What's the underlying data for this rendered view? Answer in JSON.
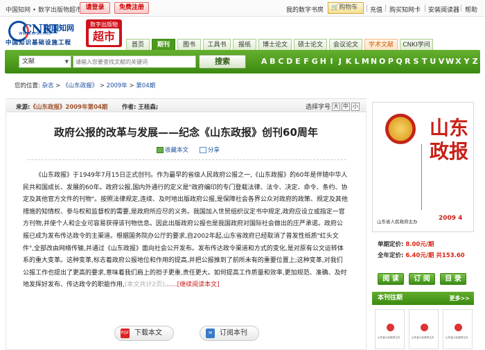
{
  "topbar": {
    "site_name": "中国知网 • 数字出版物超市",
    "login": "请登录",
    "register": "免费注册",
    "my_store": "我的数字书房",
    "cart": "购物车",
    "recharge": "充值",
    "buy_card": "购买知网卡",
    "install_reader": "安装阅读器",
    "help": "帮助"
  },
  "logo": {
    "brand": "CNKI",
    "brand_cn": "中国知网",
    "url": "www.cnki.net",
    "slogan": "中国知识基础设施工程",
    "badge_top": "数字出版物",
    "badge_main": "超市"
  },
  "nav": {
    "tabs": [
      {
        "label": "首页",
        "w": 34
      },
      {
        "label": "期刊",
        "w": 34,
        "active": true
      },
      {
        "label": "图书",
        "w": 34
      },
      {
        "label": "工具书",
        "w": 40
      },
      {
        "label": "报纸",
        "w": 34
      },
      {
        "label": "博士论文",
        "w": 48
      },
      {
        "label": "硕士论文",
        "w": 48
      },
      {
        "label": "会议论文",
        "w": 48
      },
      {
        "label": "学术文献",
        "w": 48,
        "orange": true
      },
      {
        "label": "CNKI学问",
        "w": 48
      }
    ]
  },
  "search": {
    "category": "文献",
    "placeholder": "请输入您要查找文献的关键词",
    "button": "搜索",
    "alphabet": [
      "A",
      "B",
      "C",
      "D",
      "E",
      "F",
      "G",
      "H",
      "I",
      "J",
      "K",
      "L",
      "M",
      "N",
      "O",
      "P",
      "Q",
      "R",
      "S",
      "T",
      "U",
      "V",
      "W",
      "X",
      "Y",
      "Z"
    ]
  },
  "breadcrumb": {
    "prefix": "您的位置:",
    "items": [
      "杂志",
      "《山东政报》",
      "2009年",
      "第04期"
    ]
  },
  "article": {
    "source_label": "来源:",
    "source": "《山东政报》2009年第04期",
    "author_label": "作者:",
    "author": "王桂森;",
    "font_size_label": "选择字号",
    "font_sizes": [
      "大",
      "中",
      "小"
    ],
    "title": "政府公报的改革与发展——纪念《山东政报》创刊60周年",
    "collect": "收藏本文",
    "share": "分享",
    "body": "《山东政报》于1949年7月15日正式创刊。作为最早的省级人民政府公报之一,《山东政报》的60年是伴随中华人民共和国成长、发展的60年。政府公报,国内外通行的定义是\"政府编印的专门登载法律、法令、决定、命令、条约、协定及其他官方文件的刊物\"。按照法律规定,连续、及时地出版政府公报,是保障社会各界公众对政府的政策、规定及其他措施的知情权、参与权和监督权的需要,是政府所应尽的义务。我国加入世贸组织议定书中规定,政府应设立或指定一官方刊物,并使个人和企业可容易获得该刊物信息。因此出版政府公报也是我国政府对国际社会做出的庄严承诺。政府公报已成为发布传达政令的主渠道。根据国务院办公厅的要求,自2002年起,山东省政府已经取消了普发性纸质\"红头文件\",全部改由网络传输,并通过《山东政报》面向社会公开发布。发布传达政令渠道和方式的变化,是对原有公文运转体系的重大变革。这种变革,标志着政府公报地位和作用的提高,并把公报推到了前所未有的重要位置上;这种变革,对我们公报工作也提出了更高的要求,意味着我们肩上的担子更重,责任更大。如何提高工作质量和效率,更加规范、准确、及时地发挥好发布、传达政令的职能作用,",
    "page_info": "(本文共计2页)",
    "ellipsis": "……",
    "read_more": "[继续阅读本文]",
    "download": "下载本文",
    "subscribe": "订阅本刊"
  },
  "sidebar": {
    "cover_title": "山东政报",
    "cover_publisher": "山东省人民政府主办",
    "cover_year": "2009 4",
    "single_price_label": "单期定价:",
    "single_price": "8.00元/期",
    "annual_price_label": "全年定价:",
    "annual_price": "6.40元/期",
    "annual_total": "共153.60",
    "buttons": [
      "阅 读",
      "订 阅",
      "目 录"
    ],
    "past_issues": "本刊往期",
    "more": "更多>>",
    "thumb_text": "山东省人民政府主办"
  }
}
